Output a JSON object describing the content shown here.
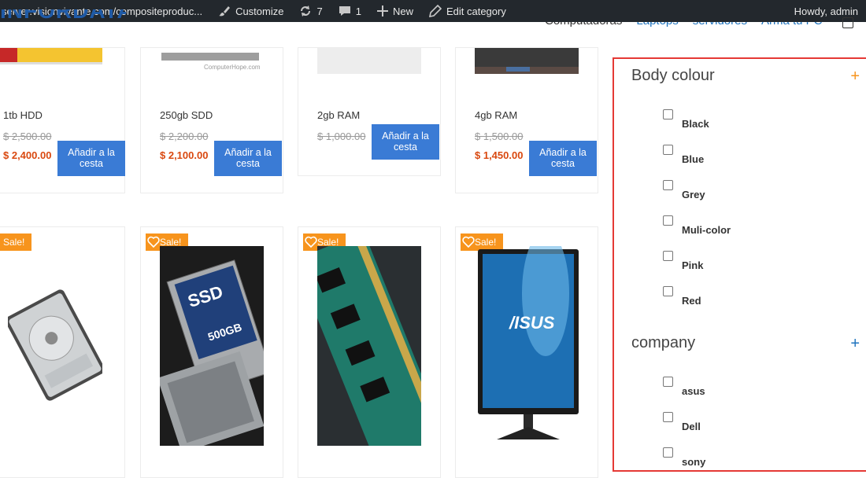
{
  "adminbar": {
    "url": "server.visionvivante.com/compositeproduc...",
    "customize": "Customize",
    "updates": "7",
    "comments": "1",
    "new": "New",
    "edit": "Edit category",
    "howdy": "Howdy, admin"
  },
  "header": {
    "logo": "INFORDATA",
    "nav": [
      "Computadoras",
      "Laptops",
      "servidores",
      "Arma tu PC"
    ]
  },
  "products_top": [
    {
      "name": "1tb HDD",
      "old_price": "$ 2,500.00",
      "price": "$ 2,400.00",
      "button": "Añadir a la cesta"
    },
    {
      "name": "250gb SDD",
      "old_price": "$ 2,200.00",
      "price": "$ 2,100.00",
      "button": "Añadir a la cesta"
    },
    {
      "name": "2gb RAM",
      "old_price": "$ 1,000.00",
      "price": "$",
      "button": "Añadir a la cesta"
    },
    {
      "name": "4gb RAM",
      "old_price": "$ 1,500.00",
      "price": "$ 1,450.00",
      "button": "Añadir a la cesta"
    }
  ],
  "products_bottom": {
    "sale_label": "Sale!"
  },
  "filter": {
    "body_colour": {
      "title": "Body colour",
      "toggle": "+",
      "toggle_color": "#f7941d",
      "options": [
        "Black",
        "Blue",
        "Grey",
        "Muli-color",
        "Pink",
        "Red"
      ]
    },
    "company": {
      "title": "company",
      "toggle": "+",
      "toggle_color": "#1e73be",
      "options": [
        "asus",
        "Dell",
        "sony"
      ]
    }
  },
  "colors": {
    "accent_blue": "#3a7bd5",
    "sale_orange": "#f7941d",
    "price_red": "#d9480f",
    "highlight_border": "#e53935"
  }
}
